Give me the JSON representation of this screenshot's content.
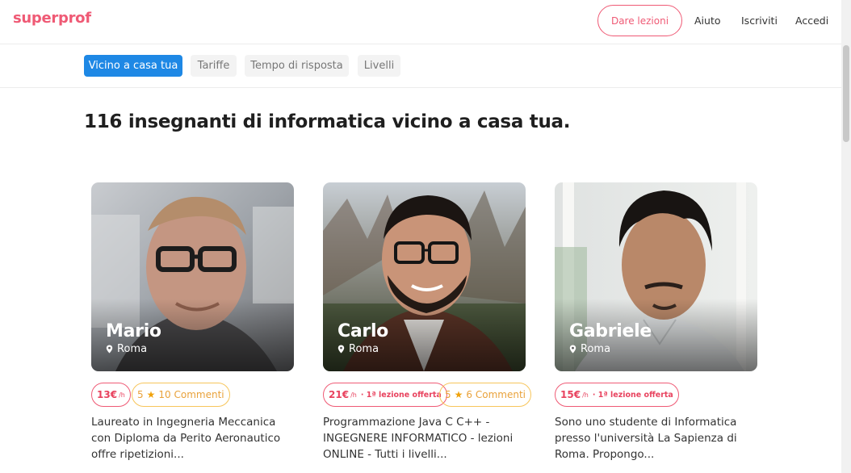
{
  "header": {
    "logo": "superprof",
    "give_lessons": "Dare lezioni",
    "help": "Aiuto",
    "signup": "Iscriviti",
    "login": "Accedi"
  },
  "filters": [
    "Vicino a casa tua",
    "Tariffe",
    "Tempo di risposta",
    "Livelli"
  ],
  "title": "116 insegnanti di informatica vicino a casa tua.",
  "colors": {
    "brand": "#ef5a75",
    "active_filter": "#1e88e5",
    "rating": "#f0a20b"
  },
  "cards": [
    {
      "name": "Mario",
      "city": "Roma",
      "price": "13€",
      "unit": "/h",
      "offer": "",
      "rating": "5",
      "reviews": "10 Commenti",
      "description": "Laureato in Ingegneria Meccanica con Diploma da Perito Aeronautico offre ripetizioni..."
    },
    {
      "name": "Carlo",
      "city": "Roma",
      "price": "21€",
      "unit": "/h",
      "offer": "· 1ª lezione offerta",
      "rating": "5",
      "reviews": "6 Commenti",
      "description": "Programmazione Java C C++ - INGEGNERE INFORMATICO - lezioni ONLINE - Tutti i livelli..."
    },
    {
      "name": "Gabriele",
      "city": "Roma",
      "price": "15€",
      "unit": "/h",
      "offer": "· 1ª lezione offerta",
      "rating": "",
      "reviews": "",
      "description": "Sono uno studente di Informatica presso l'università La Sapienza di Roma. Propongo..."
    }
  ]
}
